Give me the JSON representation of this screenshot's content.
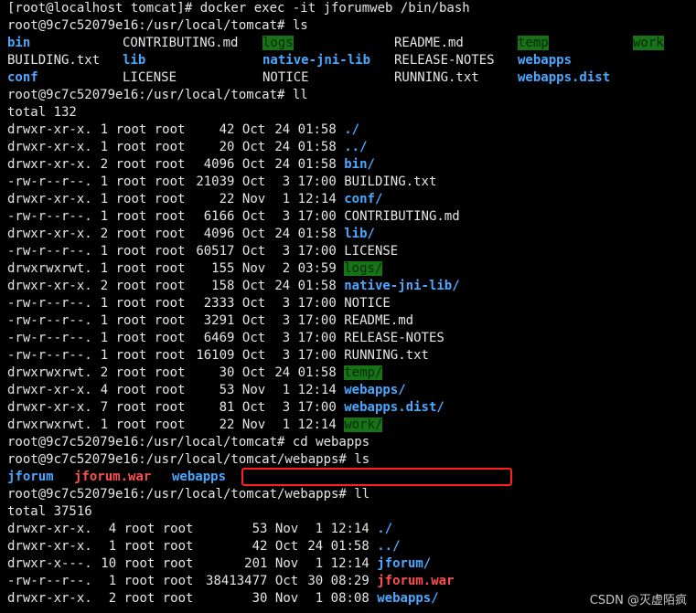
{
  "colors": {
    "background": "#000000",
    "text": "#e6e6e6",
    "directory": "#4aa8ff",
    "writable_dir_bg": "#167416",
    "archive": "#ff4f4f",
    "highlight_box": "#ff2020"
  },
  "commands": {
    "c1": "[root@localhost tomcat]# docker exec -it jforumweb /bin/bash",
    "c2": "root@9c7c52079e16:/usr/local/tomcat# ls",
    "c3": "root@9c7c52079e16:/usr/local/tomcat# ll",
    "c4": "root@9c7c52079e16:/usr/local/tomcat# cd webapps",
    "c5": "root@9c7c52079e16:/usr/local/tomcat/webapps# ls",
    "c6": "root@9c7c52079e16:/usr/local/tomcat/webapps# ll"
  },
  "ls1": {
    "r1": [
      "bin",
      "CONTRIBUTING.md",
      "logs",
      "README.md",
      "temp",
      "work"
    ],
    "r2": [
      "BUILDING.txt",
      "lib",
      "native-jni-lib",
      "RELEASE-NOTES",
      "webapps"
    ],
    "r3": [
      "conf",
      "LICENSE",
      "NOTICE",
      "RUNNING.txt",
      "webapps.dist"
    ]
  },
  "total1": "total 132",
  "ll1": [
    {
      "perm": "drwxr-xr-x.",
      "links": "1",
      "owner": "root",
      "group": "root",
      "size": "42",
      "month": "Oct",
      "day": "24",
      "time": "01:58",
      "name": "./"
    },
    {
      "perm": "drwxr-xr-x.",
      "links": "1",
      "owner": "root",
      "group": "root",
      "size": "20",
      "month": "Oct",
      "day": "24",
      "time": "01:58",
      "name": "../"
    },
    {
      "perm": "drwxr-xr-x.",
      "links": "2",
      "owner": "root",
      "group": "root",
      "size": "4096",
      "month": "Oct",
      "day": "24",
      "time": "01:58",
      "name": "bin/"
    },
    {
      "perm": "-rw-r--r--.",
      "links": "1",
      "owner": "root",
      "group": "root",
      "size": "21039",
      "month": "Oct",
      "day": "3",
      "time": "17:00",
      "name": "BUILDING.txt"
    },
    {
      "perm": "drwxr-xr-x.",
      "links": "1",
      "owner": "root",
      "group": "root",
      "size": "22",
      "month": "Nov",
      "day": "1",
      "time": "12:14",
      "name": "conf/"
    },
    {
      "perm": "-rw-r--r--.",
      "links": "1",
      "owner": "root",
      "group": "root",
      "size": "6166",
      "month": "Oct",
      "day": "3",
      "time": "17:00",
      "name": "CONTRIBUTING.md"
    },
    {
      "perm": "drwxr-xr-x.",
      "links": "2",
      "owner": "root",
      "group": "root",
      "size": "4096",
      "month": "Oct",
      "day": "24",
      "time": "01:58",
      "name": "lib/"
    },
    {
      "perm": "-rw-r--r--.",
      "links": "1",
      "owner": "root",
      "group": "root",
      "size": "60517",
      "month": "Oct",
      "day": "3",
      "time": "17:00",
      "name": "LICENSE"
    },
    {
      "perm": "drwxrwxrwt.",
      "links": "1",
      "owner": "root",
      "group": "root",
      "size": "155",
      "month": "Nov",
      "day": "2",
      "time": "03:59",
      "name": "logs/"
    },
    {
      "perm": "drwxr-xr-x.",
      "links": "2",
      "owner": "root",
      "group": "root",
      "size": "158",
      "month": "Oct",
      "day": "24",
      "time": "01:58",
      "name": "native-jni-lib/"
    },
    {
      "perm": "-rw-r--r--.",
      "links": "1",
      "owner": "root",
      "group": "root",
      "size": "2333",
      "month": "Oct",
      "day": "3",
      "time": "17:00",
      "name": "NOTICE"
    },
    {
      "perm": "-rw-r--r--.",
      "links": "1",
      "owner": "root",
      "group": "root",
      "size": "3291",
      "month": "Oct",
      "day": "3",
      "time": "17:00",
      "name": "README.md"
    },
    {
      "perm": "-rw-r--r--.",
      "links": "1",
      "owner": "root",
      "group": "root",
      "size": "6469",
      "month": "Oct",
      "day": "3",
      "time": "17:00",
      "name": "RELEASE-NOTES"
    },
    {
      "perm": "-rw-r--r--.",
      "links": "1",
      "owner": "root",
      "group": "root",
      "size": "16109",
      "month": "Oct",
      "day": "3",
      "time": "17:00",
      "name": "RUNNING.txt"
    },
    {
      "perm": "drwxrwxrwt.",
      "links": "2",
      "owner": "root",
      "group": "root",
      "size": "30",
      "month": "Oct",
      "day": "24",
      "time": "01:58",
      "name": "temp/"
    },
    {
      "perm": "drwxr-xr-x.",
      "links": "4",
      "owner": "root",
      "group": "root",
      "size": "53",
      "month": "Nov",
      "day": "1",
      "time": "12:14",
      "name": "webapps/"
    },
    {
      "perm": "drwxr-xr-x.",
      "links": "7",
      "owner": "root",
      "group": "root",
      "size": "81",
      "month": "Oct",
      "day": "3",
      "time": "17:00",
      "name": "webapps.dist/"
    },
    {
      "perm": "drwxrwxrwt.",
      "links": "1",
      "owner": "root",
      "group": "root",
      "size": "22",
      "month": "Nov",
      "day": "1",
      "time": "12:14",
      "name": "work/"
    }
  ],
  "ls2": [
    "jforum",
    "jforum.war",
    "webapps"
  ],
  "total2": "total 37516",
  "ll2": [
    {
      "perm": "drwxr-xr-x.",
      "links": "4",
      "owner": "root",
      "group": "root",
      "size": "53",
      "month": "Nov",
      "day": "1",
      "time": "12:14",
      "name": "./"
    },
    {
      "perm": "drwxr-xr-x.",
      "links": "1",
      "owner": "root",
      "group": "root",
      "size": "42",
      "month": "Oct",
      "day": "24",
      "time": "01:58",
      "name": "../"
    },
    {
      "perm": "drwxr-x---.",
      "links": "10",
      "owner": "root",
      "group": "root",
      "size": "201",
      "month": "Nov",
      "day": "1",
      "time": "12:14",
      "name": "jforum/"
    },
    {
      "perm": "-rw-r--r--.",
      "links": "1",
      "owner": "root",
      "group": "root",
      "size": "38413477",
      "month": "Oct",
      "day": "30",
      "time": "08:29",
      "name": "jforum.war"
    },
    {
      "perm": "drwxr-xr-x.",
      "links": "2",
      "owner": "root",
      "group": "root",
      "size": "30",
      "month": "Nov",
      "day": "1",
      "time": "08:08",
      "name": "webapps/"
    }
  ],
  "watermark": "CSDN @灭虚陌疯"
}
